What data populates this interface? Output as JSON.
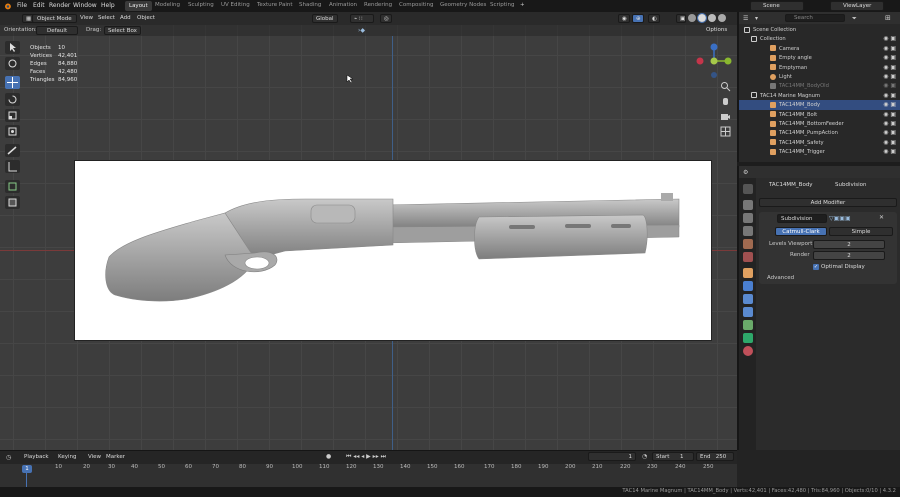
{
  "menus": [
    "File",
    "Edit",
    "Render",
    "Window",
    "Help"
  ],
  "workspaces": [
    "Layout",
    "Modeling",
    "Sculpting",
    "UV Editing",
    "Texture Paint",
    "Shading",
    "Animation",
    "Rendering",
    "Compositing",
    "Geometry Nodes",
    "Scripting",
    "+"
  ],
  "top_right": {
    "scene": "Scene",
    "view_layer": "ViewLayer"
  },
  "viewport_header": {
    "mode": "Object Mode",
    "view": "View",
    "select": "Select",
    "add": "Add",
    "object": "Object",
    "transform": "Global",
    "options": "Options"
  },
  "tool_header": {
    "orientation_label": "Orientation:",
    "orientation": "Default",
    "drag_label": "Drag:",
    "drag": "Select Box"
  },
  "stats": [
    {
      "label": "Objects",
      "value": "10"
    },
    {
      "label": "Vertices",
      "value": "42,401"
    },
    {
      "label": "Edges",
      "value": "84,880"
    },
    {
      "label": "Faces",
      "value": "42,480"
    },
    {
      "label": "Triangles",
      "value": "84,960"
    }
  ],
  "outliner": {
    "search_placeholder": "Search",
    "rows": [
      {
        "label": "Scene Collection",
        "icon": "collection-icon",
        "color": "#cccccc",
        "indent": 0
      },
      {
        "label": "Collection",
        "icon": "collection-icon",
        "color": "#cccccc",
        "indent": 1
      },
      {
        "label": "Camera",
        "icon": "camera-icon",
        "color": "#e0a060",
        "indent": 2
      },
      {
        "label": "Empty angle",
        "icon": "empty-icon",
        "color": "#e0a060",
        "indent": 2
      },
      {
        "label": "Emptyman",
        "icon": "empty-icon",
        "color": "#e0a060",
        "indent": 2
      },
      {
        "label": "Light",
        "icon": "light-icon",
        "color": "#e0a060",
        "indent": 2
      },
      {
        "label": "TAC14MM_BodyOld",
        "icon": "mesh-icon",
        "color": "#777777",
        "indent": 2
      },
      {
        "label": "TAC14 Marine Magnum",
        "icon": "collection-icon",
        "color": "#cccccc",
        "indent": 1
      },
      {
        "label": "TAC14MM_Body",
        "icon": "mesh-icon",
        "color": "#e0a060",
        "indent": 2
      },
      {
        "label": "TAC14MM_Bolt",
        "icon": "mesh-icon",
        "color": "#e0a060",
        "indent": 2
      },
      {
        "label": "TAC14MM_BottomFeeder",
        "icon": "mesh-icon",
        "color": "#e0a060",
        "indent": 2
      },
      {
        "label": "TAC14MM_PumpAction",
        "icon": "mesh-icon",
        "color": "#e0a060",
        "indent": 2
      },
      {
        "label": "TAC14MM_Safety",
        "icon": "mesh-icon",
        "color": "#e0a060",
        "indent": 2
      },
      {
        "label": "TAC14MM_Trigger",
        "icon": "mesh-icon",
        "color": "#e0a060",
        "indent": 2
      }
    ]
  },
  "properties": {
    "object": "TAC14MM_Body",
    "modifier_tab": "Subdivision",
    "add_modifier": "Add Modifier",
    "modifier_name": "Subdivision",
    "type_options": [
      "Catmull-Clark",
      "Simple"
    ],
    "levels_label": "Levels Viewport",
    "levels_value": "2",
    "render_label": "Render",
    "render_value": "2",
    "optimal_label": "Optimal Display",
    "advanced_label": "Advanced"
  },
  "timeline": {
    "menus": [
      "Playback",
      "Keying",
      "View",
      "Marker"
    ],
    "current_frame": "1",
    "start_label": "Start",
    "start": "1",
    "end_label": "End",
    "end": "250",
    "ticks": [
      "0",
      "10",
      "20",
      "30",
      "40",
      "50",
      "60",
      "70",
      "80",
      "90",
      "100",
      "110",
      "120",
      "130",
      "140",
      "150",
      "160",
      "170",
      "180",
      "190",
      "200",
      "210",
      "220",
      "230",
      "240",
      "250"
    ],
    "playhead": "1"
  },
  "status": "TAC14 Marine Magnum | TAC14MM_Body | Verts:42,401 | Faces:42,480 | Tris:84,960 | Objects:0/10 | 4.3.2"
}
